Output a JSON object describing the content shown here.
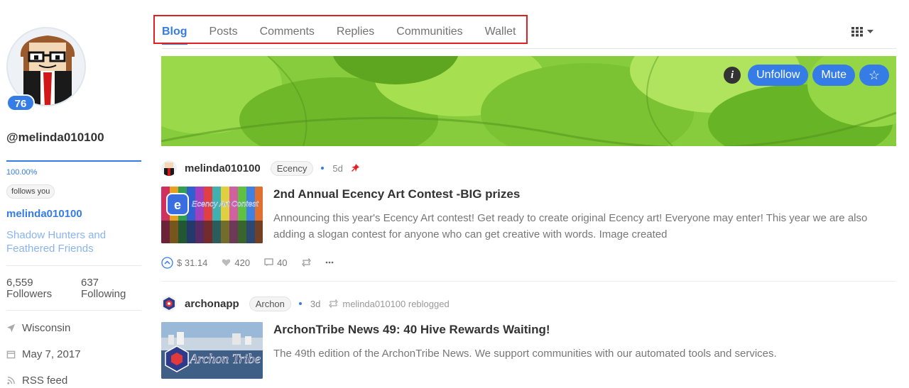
{
  "profile": {
    "reputation": "76",
    "username": "@melinda010100",
    "voting_power": "100.00%",
    "voting_power_fraction": 1.0,
    "follows_you": "follows you",
    "display_name": "melinda010100",
    "about": "Shadow Hunters and Feathered Friends",
    "followers_count": "6,559",
    "followers_label": "Followers",
    "following_count": "637",
    "following_label": "Following",
    "location": "Wisconsin",
    "joined": "May 7, 2017",
    "rss": "RSS feed"
  },
  "tabs": [
    {
      "label": "Blog",
      "active": true
    },
    {
      "label": "Posts",
      "active": false
    },
    {
      "label": "Comments",
      "active": false
    },
    {
      "label": "Replies",
      "active": false
    },
    {
      "label": "Communities",
      "active": false
    },
    {
      "label": "Wallet",
      "active": false
    }
  ],
  "cover_actions": {
    "info": "i",
    "unfollow": "Unfollow",
    "mute": "Mute",
    "favorite": "☆"
  },
  "posts": [
    {
      "author": "melinda010100",
      "community": "Ecency",
      "time": "5d",
      "pinned": true,
      "title": "2nd Annual Ecency Art Contest -BIG prizes",
      "summary": "Announcing this year's Ecency Art contest! Get ready to create original Ecency art! Everyone may enter! This year we are also adding a slogan contest for anyone who can get creative with words. Image created",
      "thumbnail_text": "Ecency Art Contest",
      "payout": "$ 31.14",
      "votes": "420",
      "comments": "40"
    },
    {
      "author": "archonapp",
      "community": "Archon",
      "time": "3d",
      "reblogged_by": "melinda010100 reblogged",
      "title": "ArchonTribe News 49: 40 Hive Rewards Waiting!",
      "summary": "The 49th edition of the ArchonTribe News. We support communities with our automated tools and services.",
      "thumbnail_text": "Archon Tribe"
    }
  ],
  "colors": {
    "accent": "#357ce6",
    "highlight": "#e02020",
    "muted_text": "#777777",
    "about_text": "#8ab4f0"
  },
  "icons": {
    "location": "location-arrow-icon",
    "calendar": "calendar-icon",
    "rss": "rss-icon",
    "pin": "pin-icon",
    "upvote": "upvote-icon",
    "heart": "heart-icon",
    "comment": "comment-icon",
    "reblog": "reblog-icon",
    "more": "more-icon",
    "grid": "grid-icon"
  }
}
